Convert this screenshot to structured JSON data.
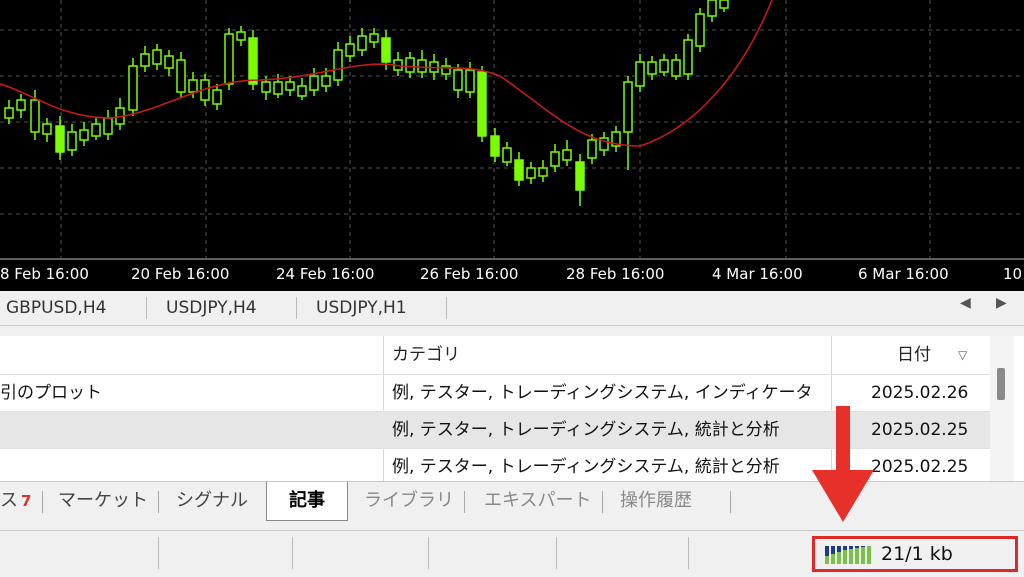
{
  "chart": {
    "background": "#000000",
    "candle_color": "#7CFC00",
    "ma_color": "#c41a1a",
    "x_labels": [
      "8 Feb 16:00",
      "20 Feb 16:00",
      "24 Feb 16:00",
      "26 Feb 16:00",
      "28 Feb 16:00",
      "4 Mar 16:00",
      "6 Mar 16:00",
      "10"
    ]
  },
  "chart_tabs": {
    "items": [
      "GBPUSD,H4",
      "USDJPY,H4",
      "USDJPY,H1"
    ],
    "scroll_left": "◀",
    "scroll_right": "▶"
  },
  "table": {
    "headers": {
      "category": "カテゴリ",
      "date": "日付",
      "sort_indicator": "▽"
    },
    "rows": [
      {
        "name": "引のプロット",
        "category": "例, テスター, トレーディングシステム, インディケータ",
        "date": "2025.02.26"
      },
      {
        "name": "",
        "category": "例, テスター, トレーディングシステム, 統計と分析",
        "date": "2025.02.25"
      },
      {
        "name": "",
        "category": "例, テスター, トレーディングシステム, 統計と分析",
        "date": "2025.02.25"
      }
    ]
  },
  "bottom_tabs": {
    "partial_label": "ス",
    "partial_badge": "7",
    "items": [
      "マーケット",
      "シグナル",
      "記事",
      "ライブラリ",
      "エキスパート",
      "操作履歴"
    ],
    "active": "記事"
  },
  "status_bar": {
    "connection_text": "21/1 kb",
    "connection_icon": "signal-bars-icon",
    "highlight_color": "#e0282a"
  },
  "annotation": {
    "arrow_color": "#e8302a",
    "arrow_icon": "down-arrow-icon"
  }
}
